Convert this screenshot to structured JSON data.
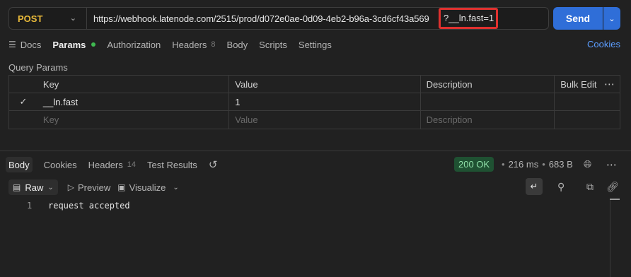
{
  "request": {
    "method": "POST",
    "url": "https://webhook.latenode.com/2515/prod/d072e0ae-0d09-4eb2-b96a-3cd6cf43a569",
    "url_query": "?__ln.fast=1",
    "send_label": "Send"
  },
  "request_tabs": {
    "docs": "Docs",
    "params": "Params",
    "authorization": "Authorization",
    "headers": "Headers",
    "headers_count": "8",
    "body": "Body",
    "scripts": "Scripts",
    "settings": "Settings",
    "cookies": "Cookies"
  },
  "query_params": {
    "title": "Query Params",
    "columns": {
      "key": "Key",
      "value": "Value",
      "description": "Description",
      "bulk_edit": "Bulk Edit"
    },
    "rows": [
      {
        "checked": true,
        "key": "__ln.fast",
        "value": "1",
        "description": ""
      }
    ],
    "placeholder": {
      "key": "Key",
      "value": "Value",
      "description": "Description"
    }
  },
  "response_tabs": {
    "body": "Body",
    "cookies": "Cookies",
    "headers": "Headers",
    "headers_count": "14",
    "test_results": "Test Results"
  },
  "response_meta": {
    "status": "200 OK",
    "time": "216 ms",
    "size": "683 B"
  },
  "format_bar": {
    "raw": "Raw",
    "preview": "Preview",
    "visualize": "Visualize"
  },
  "response_body": {
    "lines": [
      {
        "number": "1",
        "text": "request accepted"
      }
    ]
  },
  "colors": {
    "method": "#e8b93a",
    "send": "#2f6ed8",
    "status_badge_bg": "#1f5132",
    "status_badge_text": "#8fe0a8",
    "highlight_box": "#e0312f",
    "link": "#5b9dff"
  }
}
